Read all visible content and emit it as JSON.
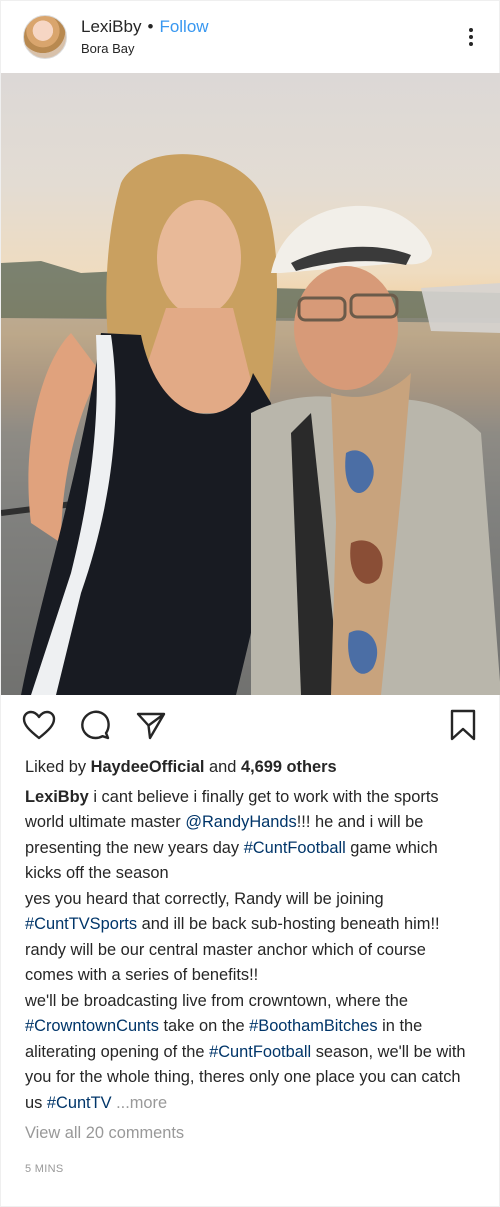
{
  "header": {
    "username": "LexiBby",
    "separator": "•",
    "follow_label": "Follow",
    "location": "Bora Bay"
  },
  "icons": {
    "more": "more-vertical-icon",
    "like": "heart-icon",
    "comment": "comment-icon",
    "share": "share-icon",
    "save": "bookmark-icon"
  },
  "likes": {
    "prefix": "Liked by ",
    "user": "HaydeeOfficial",
    "middle": " and ",
    "count": "4,699 others"
  },
  "caption": {
    "author": "LexiBby",
    "p1a": " i cant believe i finally get to work with the sports world ultimate master ",
    "mention": "@RandyHands",
    "p1b": "!!! he and i will be presenting the new years day ",
    "tag1": "#CuntFootball",
    "p1c": " game which kicks off the season",
    "p2a": "yes you heard that correctly, Randy will be joining ",
    "tag2": "#CuntTVSports",
    "p2b": " and ill be back sub-hosting beneath him!! randy will be our central master anchor which of course comes with a series of benefits!!",
    "p3a": "we'll be broadcasting live from crowntown, where the ",
    "tag3": "#CrowntownCunts",
    "p3b": " take on the ",
    "tag4": "#BoothamBitches",
    "p3c": " in the aliterating opening of the ",
    "tag5": "#CuntFootball",
    "p3d": " season, we'll be with you for the whole thing, theres only one place you can catch us ",
    "tag6": "#CuntTV",
    "more": " ...more"
  },
  "comments_link": "View all 20 comments",
  "timestamp": "5 MINS",
  "colors": {
    "link_blue": "#3897f0",
    "tag_blue": "#003569",
    "muted": "#999999",
    "text": "#262626"
  }
}
